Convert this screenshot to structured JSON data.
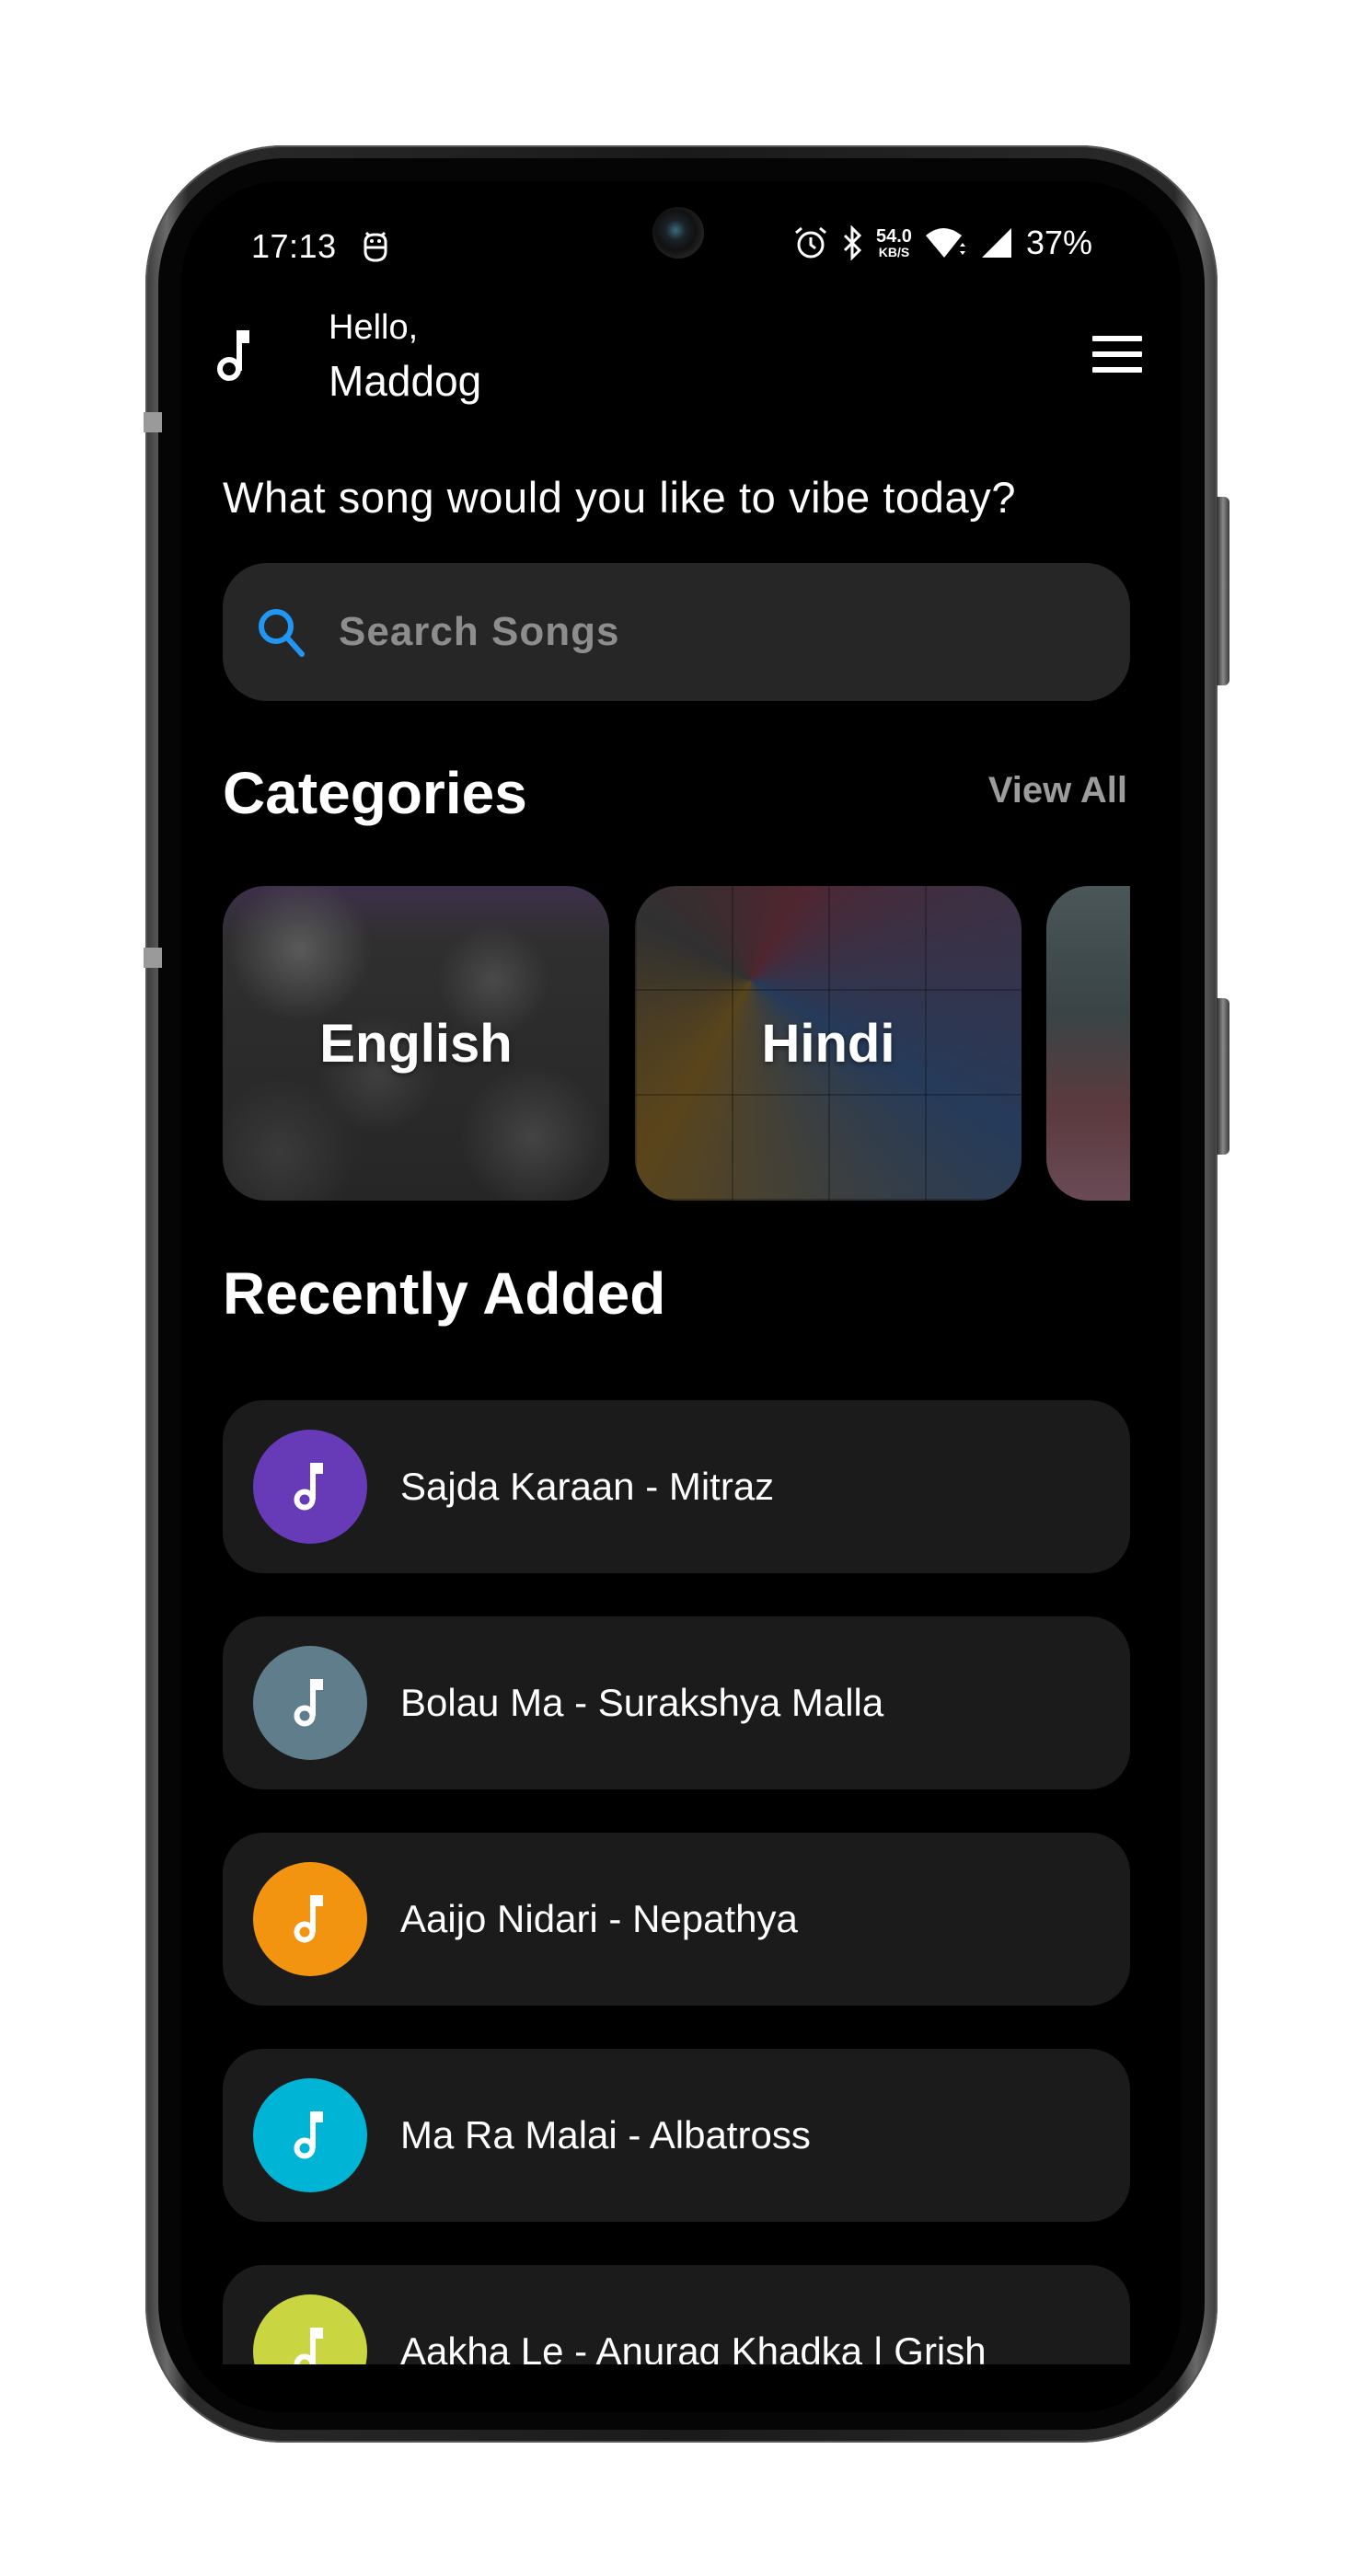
{
  "status_bar": {
    "time": "17:13",
    "notification_icon": "android-bot-icon",
    "icons": [
      "alarm-icon",
      "bluetooth-icon",
      "wifi-icon",
      "cell-signal-icon"
    ],
    "net_speed_value": "54.0",
    "net_speed_unit": "KB/S",
    "battery": "37%"
  },
  "header": {
    "logo_icon": "music-note-icon",
    "greeting": "Hello,",
    "user_name": "Maddog",
    "menu_icon": "hamburger-menu-icon"
  },
  "prompt": "What song would you like to vibe today?",
  "search": {
    "placeholder": "Search Songs",
    "value": "",
    "icon": "search-icon",
    "icon_color": "#2196F3"
  },
  "categories": {
    "title": "Categories",
    "view_all_label": "View All",
    "items": [
      {
        "label": "English"
      },
      {
        "label": "Hindi"
      },
      {
        "label": ""
      }
    ]
  },
  "recently_added": {
    "title": "Recently Added",
    "songs": [
      {
        "title": "Sajda Karaan - Mitraz",
        "color": "#673AB7"
      },
      {
        "title": "Bolau Ma - Surakshya Malla",
        "color": "#607D8B"
      },
      {
        "title": "Aaijo Nidari - Nepathya",
        "color": "#F39410"
      },
      {
        "title": "Ma Ra Malai - Albatross",
        "color": "#00B4D6"
      },
      {
        "title": "Aakha Le - Anurag Khadka | Grish",
        "color": "#C9D641"
      }
    ]
  },
  "colors": {
    "background": "#000000",
    "card_background": "#1B1B1B",
    "search_background": "#262626",
    "muted_text": "#9C9C9C"
  }
}
